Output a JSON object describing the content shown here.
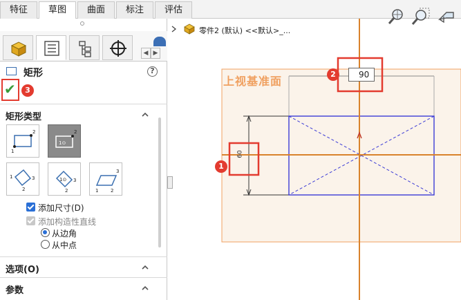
{
  "tabs": [
    "特征",
    "草图",
    "曲面",
    "标注",
    "评估"
  ],
  "active_tab": "草图",
  "panel": {
    "title": "矩形",
    "help_label": "?",
    "confirm_label": "✔",
    "icons": [
      "feature-manager-icon",
      "property-manager-icon",
      "configuration-manager-icon",
      "dimxpert-icon",
      "display-manager-icon"
    ],
    "section_rect_type": "矩形类型",
    "add_dimensions": "添加尺寸(D)",
    "add_construction": "添加构造性直线",
    "from_corner": "从边角",
    "from_midpoint": "从中点",
    "section_options": "选项(O)",
    "section_params": "参数"
  },
  "canvas": {
    "breadcrumb": "零件2 (默认) <<默认>_...",
    "plane_label": "上视基准面",
    "dimension_value": "90",
    "vertical_dimension": "60"
  },
  "markers": [
    "1",
    "2",
    "3"
  ],
  "colors": {
    "marker_red": "#e33b2f",
    "plane_orange": "#f0a060",
    "axis_orange": "#d9822b",
    "sketch_blue": "#3b3bd6",
    "check_green": "#3a9a3a"
  }
}
